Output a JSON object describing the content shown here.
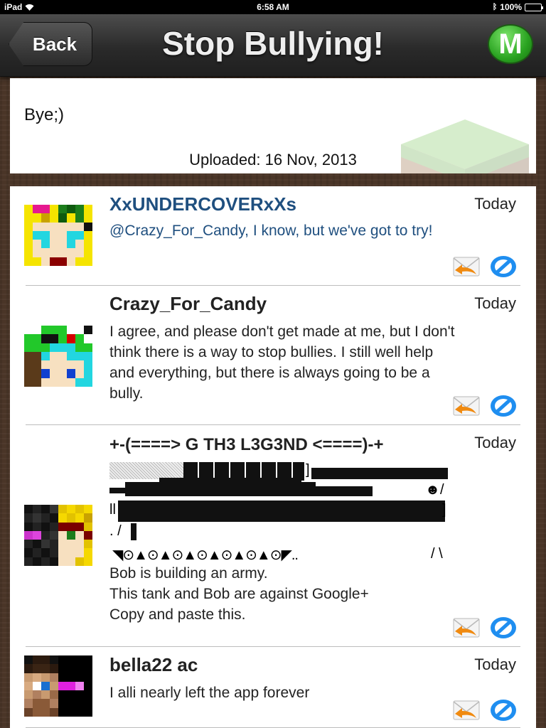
{
  "status_bar": {
    "device": "iPad",
    "time": "6:58 AM",
    "battery": "100%"
  },
  "nav": {
    "back_label": "Back",
    "title": "Stop Bullying!",
    "menu_label": "M"
  },
  "post": {
    "text": "Bye;)",
    "uploaded": "Uploaded: 16 Nov, 2013"
  },
  "comments": [
    {
      "username": "XxUNDERCOVERxXs",
      "time": "Today",
      "message": "@Crazy_For_Candy, I know, but we've got to try!"
    },
    {
      "username": "Crazy_For_Candy",
      "time": "Today",
      "message": "I agree, and please don't get made at me, but I don't think there is a way to stop bullies. I still well help and everything, but there is always going to be a bully."
    },
    {
      "username": "+-(====> G TH3 L3G3ND <====)-+",
      "time": "Today",
      "tank_row_1": "]",
      "tank_row_3_smiley": "☻/",
      "tank_row_4_left": "ll",
      "tank_row_4_right": "]",
      "tank_row_5": ". /",
      "tank_row_6": "◥⊙▲⊙▲⊙▲⊙▲⊙▲⊙▲⊙◤..",
      "tank_row_6_right": "/ \\",
      "message": "Bob is building an army.\nThis tank and Bob are against Google+\nCopy and paste this."
    },
    {
      "username": "bella22 ac",
      "time": "Today",
      "message": "I alli nearly left the app forever"
    }
  ],
  "icons": {
    "reply": "reply-envelope-icon",
    "block": "block-icon"
  },
  "colors": {
    "accent_blue": "#1f4f7f",
    "menu_green": "#2aa321"
  }
}
